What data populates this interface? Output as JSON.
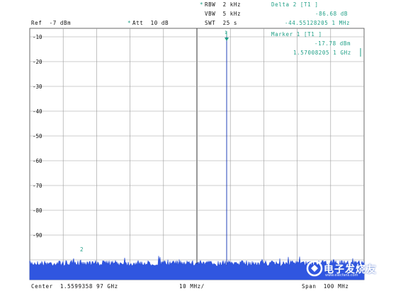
{
  "settings": {
    "rbw_star": "*",
    "rbw": "RBW  2 kHz",
    "vbw": "VBW  5 kHz",
    "swt": "SWT  25 s",
    "ref": "Ref  -7 dBm",
    "att_star": "*",
    "att": "Att  10 dB"
  },
  "delta2": {
    "title": "Delta 2 [T1 ]",
    "level": "-86.68 dB",
    "freq": "-44.55128205 1 MHz"
  },
  "marker1": {
    "title": "Marker 1 [T1 ]",
    "level": "-17.78 dBm",
    "freq": "1.57008205 1 GHz"
  },
  "y_labels": [
    "-10",
    "-20",
    "-30",
    "-40",
    "-50",
    "-60",
    "-70",
    "-80",
    "-90"
  ],
  "marker2_label": "2",
  "marker1_label": "1",
  "footer": {
    "center": "Center  1.5599358 97 GHz",
    "div": "10 MHz/",
    "span": "Span  100 MHz"
  },
  "watermark": {
    "text": "电子发烧友",
    "sub": "www.elecfans.com"
  },
  "colors": {
    "grid": "#9a9a9a",
    "trace": "#2b4fd6",
    "trace_fill": "#3056e0",
    "text_green": "#1f9f86",
    "marker_line": "#2340b8"
  },
  "chart_data": {
    "type": "line",
    "y_ticks": [
      -10,
      -20,
      -30,
      -40,
      -50,
      -60,
      -70,
      -80,
      -90
    ],
    "noise_floor_dbm": -97,
    "peak_level_dbm": -17.78,
    "peak_freq_ghz": 1.57008205,
    "center_freq_ghz": 1.5599358,
    "span_mhz": 100,
    "ref_level_dbm": -7
  }
}
